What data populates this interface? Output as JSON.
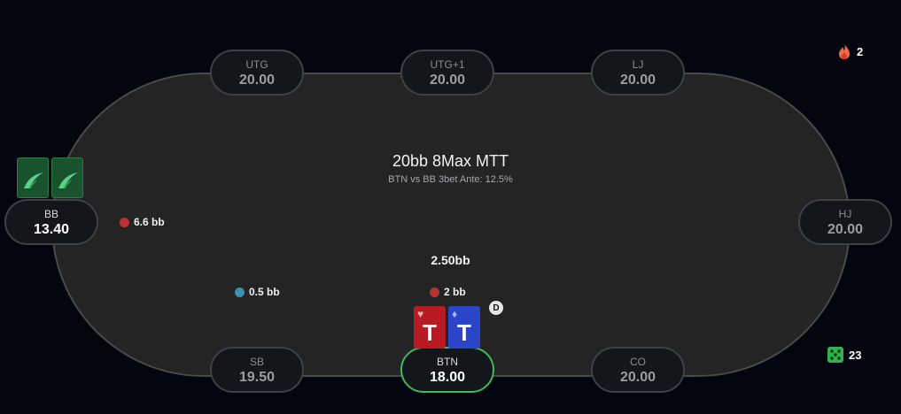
{
  "table": {
    "title": "20bb 8Max MTT",
    "subtitle": "BTN vs BB 3bet Ante: 12.5%",
    "pot": "2.50bb"
  },
  "seats": {
    "utg": {
      "pos": "UTG",
      "stack": "20.00"
    },
    "utg1": {
      "pos": "UTG+1",
      "stack": "20.00"
    },
    "lj": {
      "pos": "LJ",
      "stack": "20.00"
    },
    "hj": {
      "pos": "HJ",
      "stack": "20.00"
    },
    "co": {
      "pos": "CO",
      "stack": "20.00"
    },
    "btn": {
      "pos": "BTN",
      "stack": "18.00"
    },
    "sb": {
      "pos": "SB",
      "stack": "19.50"
    },
    "bb": {
      "pos": "BB",
      "stack": "13.40"
    }
  },
  "bets": {
    "bb": "6.6 bb",
    "sb": "0.5 bb",
    "btn": "2 bb"
  },
  "dealer_button": "D",
  "hero_cards": [
    {
      "rank": "T",
      "suit": "♥",
      "color": "#b81c22"
    },
    {
      "rank": "T",
      "suit": "♦",
      "color": "#2b45c8"
    }
  ],
  "stats": {
    "streak": "2",
    "dice": "23"
  },
  "colors": {
    "chip_red": "#b83232",
    "chip_blue": "#3b8fb0",
    "hero_ring": "#3fb95b",
    "flame": "#f06a4a",
    "dice": "#2fb34a"
  },
  "icons": {
    "streak": "flame-icon",
    "dice": "dice-icon",
    "card_back": "card-back-logo-icon"
  }
}
